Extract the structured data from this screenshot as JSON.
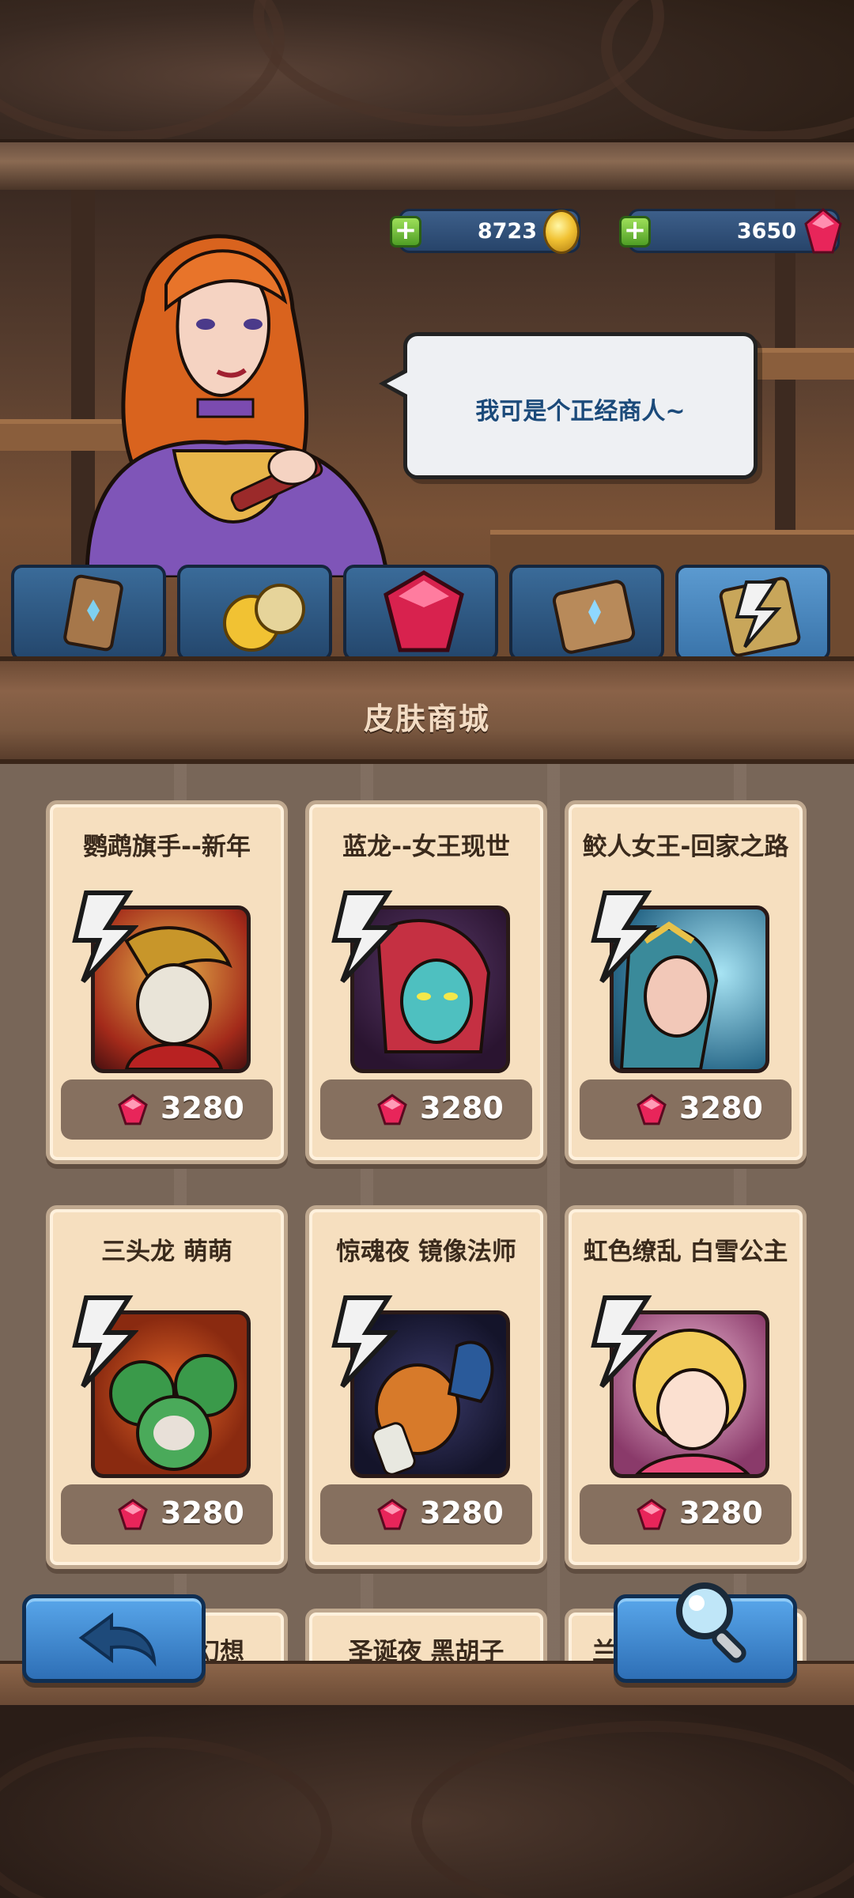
{
  "currency": {
    "gold": "8723",
    "gems": "3650"
  },
  "merchant": {
    "speech": "我可是个正经商人~"
  },
  "tabs": [
    "bag-icon",
    "coin-icon",
    "gem-icon",
    "scroll-icon",
    "skin-card-icon"
  ],
  "shop": {
    "title": "皮肤商城",
    "items": [
      {
        "name": "鹦鹉旗手--新年",
        "price": "3280"
      },
      {
        "name": "蓝龙--女王现世",
        "price": "3280"
      },
      {
        "name": "鲛人女王-回家之路",
        "price": "3280"
      },
      {
        "name": "三头龙 萌萌",
        "price": "3280"
      },
      {
        "name": "惊魂夜 镜像法师",
        "price": "3280"
      },
      {
        "name": "虹色缭乱 白雪公主",
        "price": "3280"
      },
      {
        "name": "幻想"
      },
      {
        "name": "圣诞夜 黑胡子"
      },
      {
        "name": "兰"
      }
    ]
  },
  "colors": {
    "accent_blue": "#3a74aa",
    "card_bg": "#f6dfbf",
    "gem": "#e8255a"
  }
}
